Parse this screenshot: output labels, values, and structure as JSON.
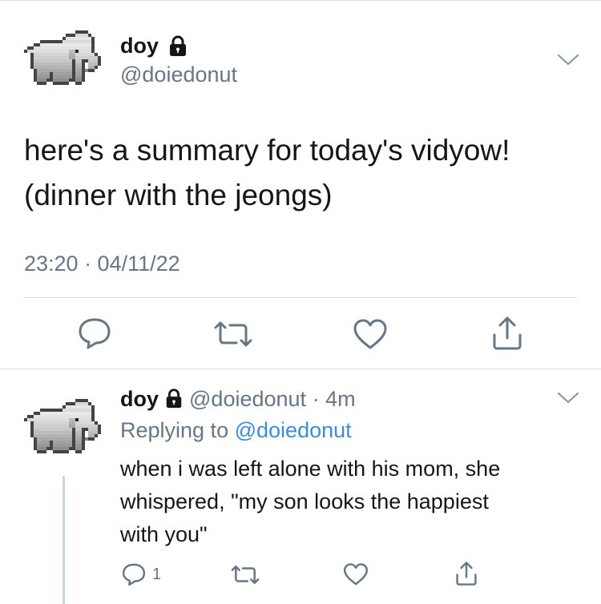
{
  "main_tweet": {
    "display_name": "doy",
    "handle": "@doiedonut",
    "text": "here's a summary for today's vidyow!\n(dinner with the jeongs)",
    "timestamp": "23:20 · 04/11/22",
    "icons": [
      "lock-icon",
      "chevron-down-icon",
      "reply-icon",
      "retweet-icon",
      "like-icon",
      "share-icon"
    ]
  },
  "reply_tweet": {
    "display_name": "doy",
    "handle": "@doiedonut",
    "dot": "·",
    "time_ago": "4m",
    "replying_prefix": "Replying to",
    "replying_to": "@doiedonut",
    "text": "when i was left alone with his mom, she\nwhispered, \"my son looks the happiest\nwith you\"",
    "reply_count": "1",
    "icons": [
      "lock-icon",
      "chevron-down-icon",
      "reply-icon",
      "retweet-icon",
      "like-icon",
      "share-icon"
    ]
  },
  "colors": {
    "text": "#14171a",
    "secondary": "#657786",
    "link": "#3b8ddc",
    "divider": "#d8dde1"
  }
}
